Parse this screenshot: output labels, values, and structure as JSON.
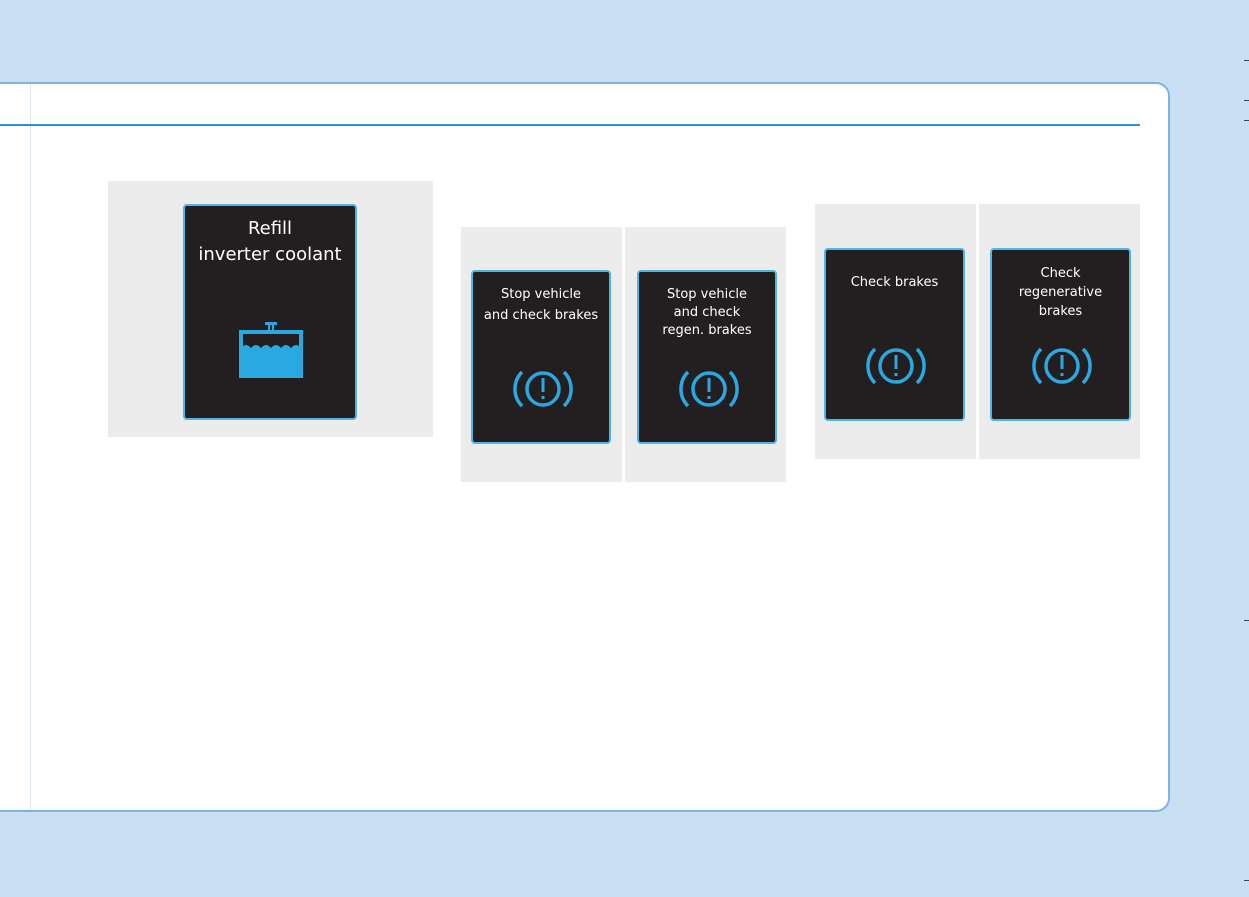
{
  "colors": {
    "background": "#c9dff3",
    "accent_rule": "#2f8fd8",
    "screen_background": "#231f20",
    "screen_border": "#4fb5e6",
    "icon_blue": "#2aa8e0"
  },
  "panels": [
    {
      "displays": [
        {
          "message": "Refill\ninverter coolant",
          "icon": "coolant-reservoir-icon"
        }
      ]
    },
    {
      "displays": [
        {
          "message": "Stop vehicle\nand check brakes",
          "icon": "brake-warning-icon"
        },
        {
          "message": "Stop vehicle\nand check\nregen. brakes",
          "icon": "brake-warning-icon"
        }
      ]
    },
    {
      "displays": [
        {
          "message": "Check brakes",
          "icon": "brake-warning-icon"
        },
        {
          "message": "Check\nregenerative\nbrakes",
          "icon": "brake-warning-icon"
        }
      ]
    }
  ]
}
